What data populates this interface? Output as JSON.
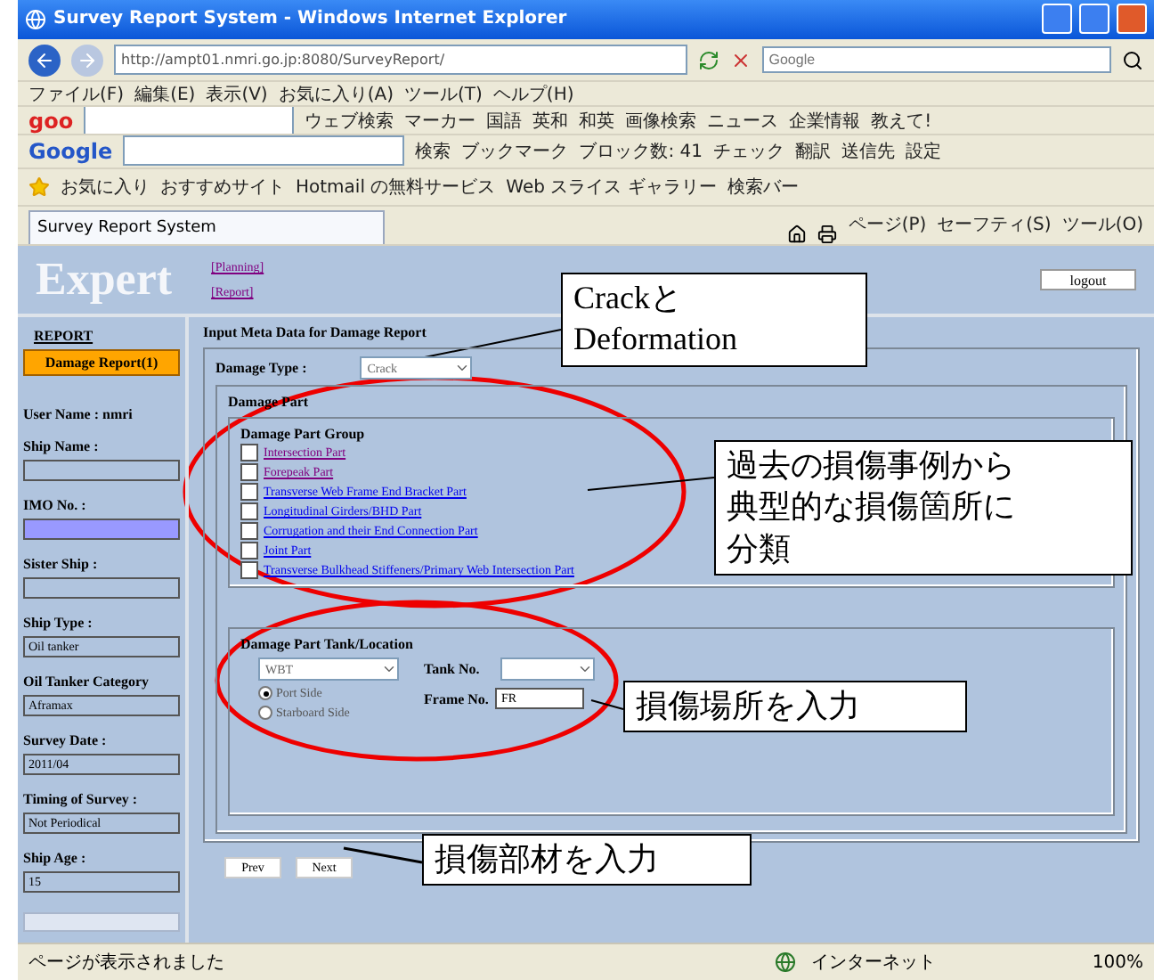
{
  "window": {
    "title": "Survey Report System - Windows Internet Explorer"
  },
  "address_bar": {
    "url": "http://ampt01.nmri.go.jp:8080/SurveyReport/",
    "search_placeholder": "Google"
  },
  "menu": [
    "ファイル(F)",
    "編集(E)",
    "表示(V)",
    "お気に入り(A)",
    "ツール(T)",
    "ヘルプ(H)"
  ],
  "goo_toolbar": {
    "logo": "goo",
    "items": [
      "ウェブ検索",
      "マーカー",
      "国語",
      "英和",
      "和英",
      "画像検索",
      "ニュース",
      "企業情報",
      "教えて!"
    ]
  },
  "google_toolbar": {
    "logo": "Google",
    "items": [
      "検索",
      "ブックマーク",
      "ブロック数: 41",
      "チェック",
      "翻訳",
      "送信先",
      "設定"
    ]
  },
  "favorites_bar": [
    "お気に入り",
    "おすすめサイト",
    "Hotmail の無料サービス",
    "Web スライス ギャラリー",
    "検索バー"
  ],
  "tab": {
    "title": "Survey Report System"
  },
  "command_bar": [
    "ページ(P)",
    "セーフティ(S)",
    "ツール(O)"
  ],
  "page": {
    "logo": "Expert",
    "nav_links": [
      "[Planning]",
      "[Report]"
    ],
    "logout": "logout",
    "sidebar": {
      "heading": "REPORT",
      "report_button": "Damage Report(1)",
      "user": "User Name : nmri",
      "fields": [
        {
          "label": "Ship Name :",
          "highlighted": false
        },
        {
          "label": "IMO No. :",
          "highlighted": true
        },
        {
          "label": "Sister Ship :",
          "highlighted": false
        },
        {
          "label": "Ship Type :",
          "value": "Oil tanker",
          "highlighted": false
        },
        {
          "label": "Oil Tanker Category",
          "value": "Aframax",
          "highlighted": false
        },
        {
          "label": "Survey Date :",
          "value": "2011/04",
          "highlighted": false
        },
        {
          "label": "Timing of Survey :",
          "value": "Not Periodical",
          "highlighted": false
        },
        {
          "label": "Ship Age :",
          "value": "15",
          "highlighted": false
        }
      ]
    },
    "main": {
      "title": "Input Meta Data for Damage Report",
      "damage_type": {
        "label": "Damage Type :",
        "value": "Crack"
      },
      "damage_part": {
        "legend": "Damage Part",
        "group_legend": "Damage Part Group",
        "groups": [
          {
            "label": "Intersection Part",
            "checked": false,
            "visited": true
          },
          {
            "label": "Forepeak Part",
            "checked": false,
            "visited": true
          },
          {
            "label": "Transverse Web Frame End Bracket Part",
            "checked": false,
            "visited": false
          },
          {
            "label": "Longitudinal Girders/BHD Part",
            "checked": false,
            "visited": false
          },
          {
            "label": "Corrugation and their End Connection Part",
            "checked": false,
            "visited": false
          },
          {
            "label": "Joint Part",
            "checked": false,
            "visited": false
          },
          {
            "label": "Transverse Bulkhead Stiffeners/Primary Web Intersection Part",
            "checked": false,
            "visited": false
          }
        ]
      },
      "location": {
        "legend": "Damage Part Tank/Location",
        "tank_type": "WBT",
        "sides": [
          {
            "label": "Port Side",
            "selected": true
          },
          {
            "label": "Starboard Side",
            "selected": false
          }
        ],
        "tank_no_label": "Tank No.",
        "frame_no_label": "Frame No.",
        "frame_no": "FR"
      },
      "buttons": [
        "Prev",
        "Next"
      ]
    }
  },
  "annotations": [
    {
      "lines": [
        "Crackと",
        "Deformation"
      ]
    },
    {
      "lines": [
        "過去の損傷事例から",
        "典型的な損傷箇所に",
        "分類"
      ]
    },
    {
      "lines": [
        "損傷場所を入力"
      ]
    },
    {
      "lines": [
        "損傷部材を入力"
      ]
    }
  ],
  "status_bar": {
    "message": "ページが表示されました",
    "zone": "インターネット",
    "zoom": "100%"
  }
}
